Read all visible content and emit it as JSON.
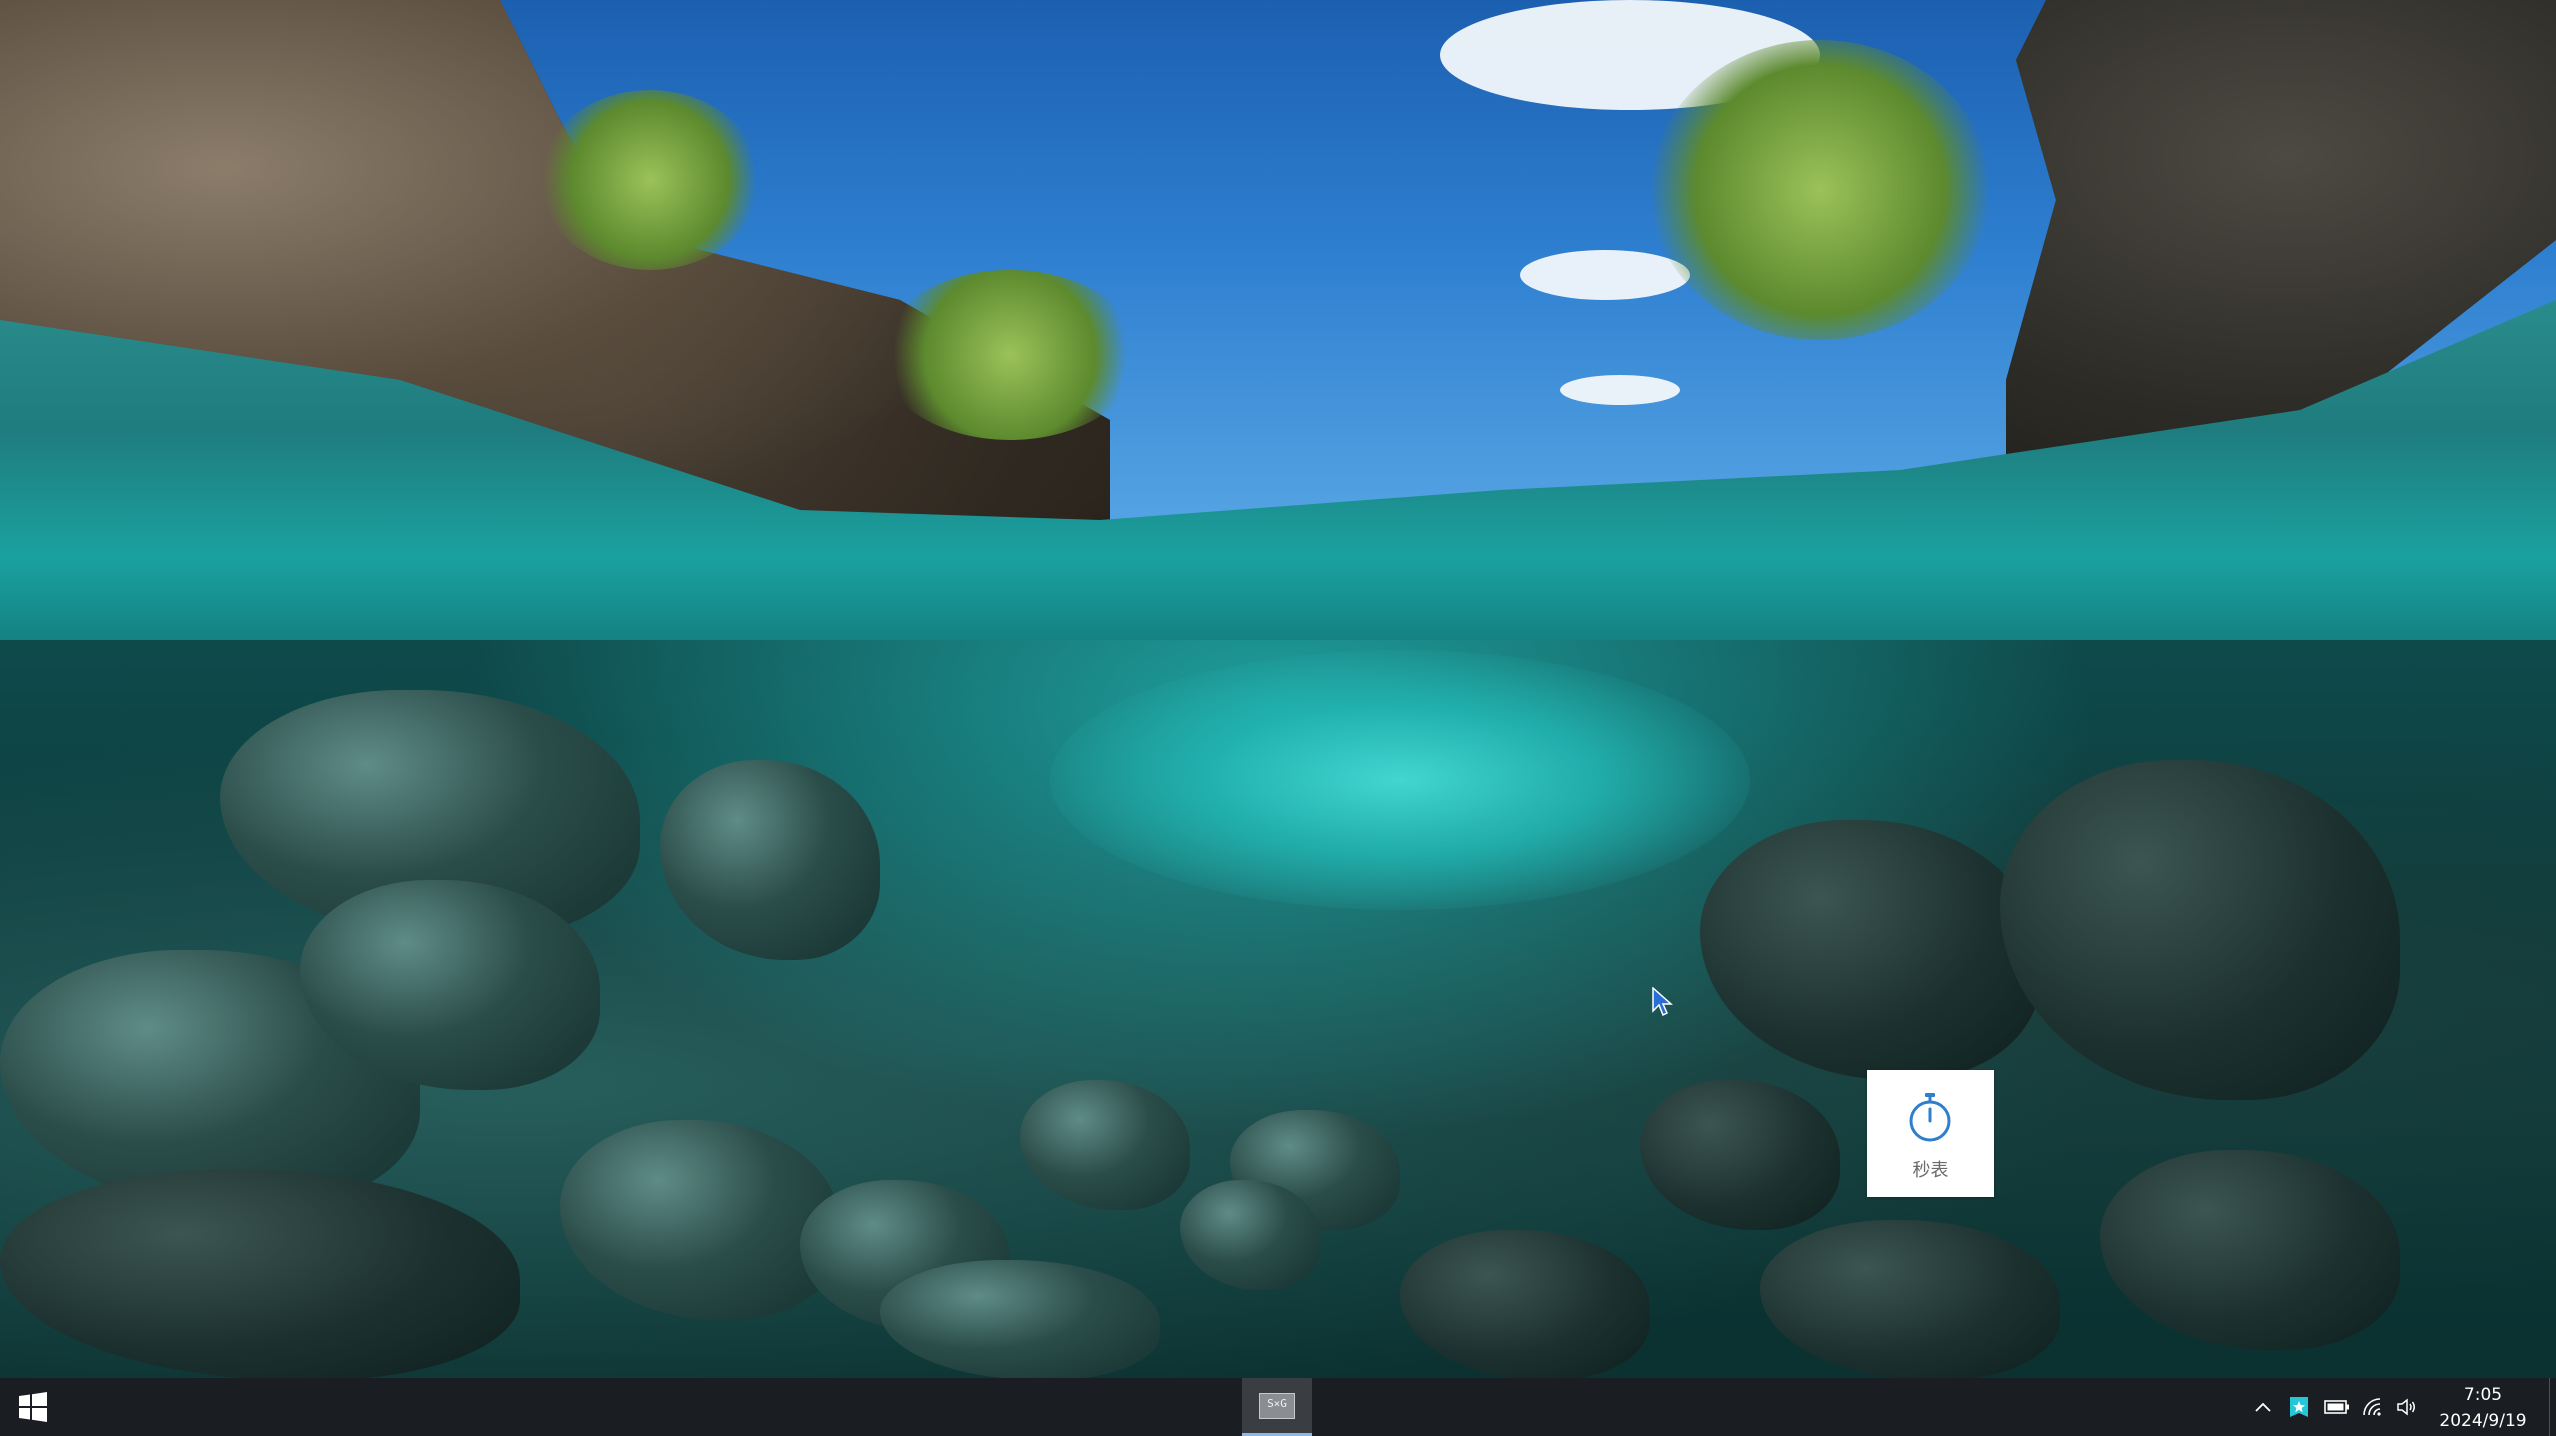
{
  "desktop": {
    "widgets": [
      {
        "label": "秒表",
        "icon": "stopwatch-icon",
        "accent": "#2f7fcb"
      }
    ]
  },
  "taskbar": {
    "start_icon": "windows-logo-icon",
    "running_app": {
      "thumb_text": "S×G",
      "icon": "app-window-icon"
    },
    "tray": {
      "icons": [
        "chevron-up-icon",
        "pinned-star-app-icon",
        "battery-icon",
        "wifi-icon",
        "volume-icon"
      ]
    },
    "clock": {
      "time": "7:05",
      "date": "2024/9/19"
    },
    "background": "#1a1e22"
  }
}
